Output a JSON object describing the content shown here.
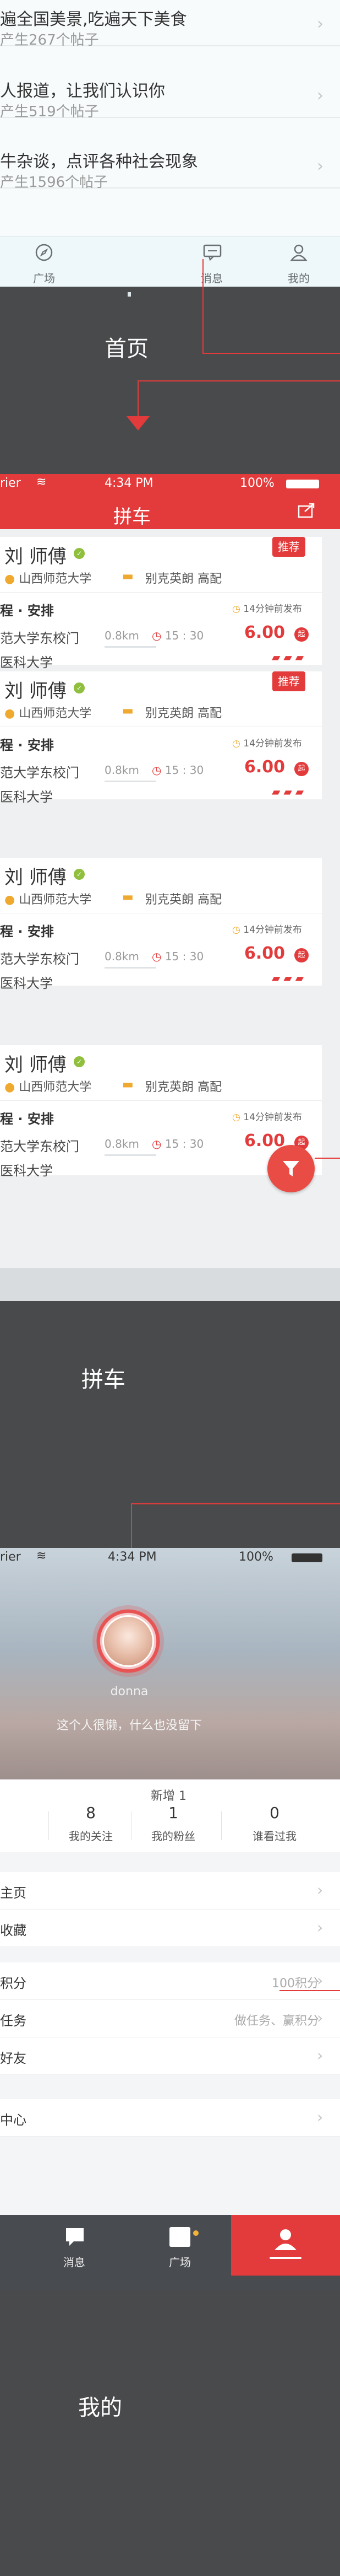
{
  "home": {
    "topics": [
      {
        "title": "遍全国美景,吃遍天下美食",
        "count": "产生267个帖子"
      },
      {
        "title": "人报道，让我们认识你",
        "count": "产生519个帖子"
      },
      {
        "title": "牛杂谈，点评各种社会现象",
        "count": "产生1596个帖子"
      }
    ],
    "tabs": [
      {
        "label": "广场",
        "icon": "compass-icon"
      },
      {
        "label": "消息",
        "icon": "chat-icon"
      },
      {
        "label": "我的",
        "icon": "person-icon"
      }
    ],
    "caption": "首页"
  },
  "carpool": {
    "status_left": "rier",
    "status_time": "4:34 PM",
    "status_battery": "100%",
    "title": "拼车",
    "share_icon": "share-icon",
    "badge": "推荐",
    "cards": [
      {
        "name": "刘 师傅",
        "school": "山西师范大学",
        "car": "别克英朗 高配",
        "trip": "程 · 安排",
        "published": "14分钟前发布",
        "from": "范大学东校门",
        "distance": "0.8km",
        "time": "15 : 30",
        "price": "6.00",
        "price_unit": "起",
        "to": "医科大学",
        "featured": true
      },
      {
        "name": "刘 师傅",
        "school": "山西师范大学",
        "car": "别克英朗 高配",
        "trip": "程 · 安排",
        "published": "14分钟前发布",
        "from": "范大学东校门",
        "distance": "0.8km",
        "time": "15 : 30",
        "price": "6.00",
        "price_unit": "起",
        "to": "医科大学",
        "featured": true
      },
      {
        "name": "刘 师傅",
        "school": "山西师范大学",
        "car": "别克英朗 高配",
        "trip": "程 · 安排",
        "published": "14分钟前发布",
        "from": "范大学东校门",
        "distance": "0.8km",
        "time": "15 : 30",
        "price": "6.00",
        "price_unit": "起",
        "to": "医科大学",
        "featured": false
      },
      {
        "name": "刘 师傅",
        "school": "山西师范大学",
        "car": "别克英朗 高配",
        "trip": "程 · 安排",
        "published": "14分钟前发布",
        "from": "范大学东校门",
        "distance": "0.8km",
        "time": "15 : 30",
        "price": "6.00",
        "price_unit": "起",
        "to": "医科大学",
        "featured": false
      }
    ],
    "caption": "拼车"
  },
  "mine": {
    "status_left": "rier",
    "status_time": "4:34 PM",
    "status_battery": "100%",
    "username": "donna",
    "bio": "这个人很懒，什么也没留下",
    "new_followers": "新增 1",
    "stats": [
      {
        "value": "8",
        "label": "我的关注"
      },
      {
        "value": "1",
        "label": "我的粉丝"
      },
      {
        "value": "0",
        "label": "谁看过我"
      }
    ],
    "rows": [
      {
        "label": "主页",
        "value": ""
      },
      {
        "label": "收藏",
        "value": ""
      },
      {
        "label": "积分",
        "value": "100积分"
      },
      {
        "label": "任务",
        "value": "做任务、赢积分"
      },
      {
        "label": "好友",
        "value": ""
      },
      {
        "label": "中心",
        "value": ""
      }
    ],
    "tabs": [
      {
        "label": "消息"
      },
      {
        "label": "广场"
      },
      {
        "label": ""
      }
    ],
    "caption": "我的"
  }
}
